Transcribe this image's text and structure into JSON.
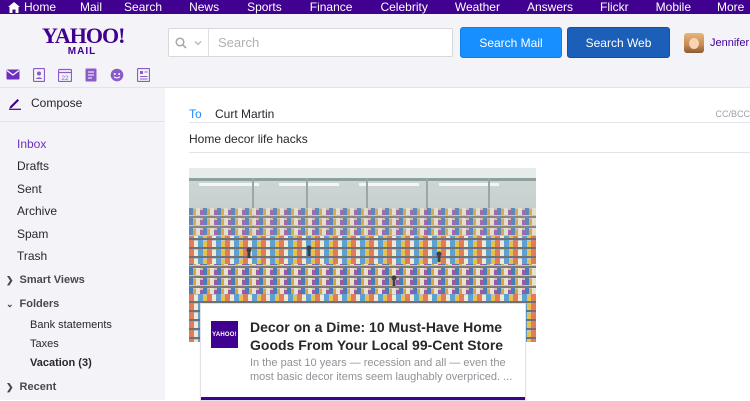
{
  "topnav": {
    "items": [
      "Home",
      "Mail",
      "Search",
      "News",
      "Sports",
      "Finance",
      "Celebrity",
      "Weather",
      "Answers",
      "Flickr",
      "Mobile",
      "More"
    ],
    "bg_color": "#400090"
  },
  "header": {
    "logo_line1": "YAHOO!",
    "logo_line2": "MAIL",
    "search_placeholder": "Search",
    "search_mail_label": "Search Mail",
    "search_web_label": "Search Web",
    "user_name": "Jennifer"
  },
  "appbar": {
    "icons": [
      "mail-icon",
      "contacts-icon",
      "calendar-icon",
      "notepad-icon",
      "messenger-icon",
      "newsfeed-icon"
    ],
    "calendar_day": "22"
  },
  "sidebar": {
    "compose_label": "Compose",
    "folders": [
      "Inbox",
      "Drafts",
      "Sent",
      "Archive",
      "Spam",
      "Trash"
    ],
    "active_folder": "Inbox",
    "smart_views_label": "Smart Views",
    "folders_label": "Folders",
    "user_folders": [
      "Bank statements",
      "Taxes",
      "Vacation (3)"
    ],
    "recent_label": "Recent"
  },
  "compose": {
    "to_label": "To",
    "to_value": "Curt Martin",
    "cc_bcc_label": "CC/BCC",
    "subject": "Home decor life hacks"
  },
  "article": {
    "source_logo": "YAHOO!",
    "title": "Decor on a Dime: 10 Must-Have Home Goods From Your Local 99-Cent Store",
    "description": "In the past 10 years — recession and all — even the most basic decor items seem laughably overpriced. ..."
  },
  "colors": {
    "brand_purple": "#400090",
    "accent_blue": "#188fff",
    "dark_blue": "#1b5fb8"
  }
}
